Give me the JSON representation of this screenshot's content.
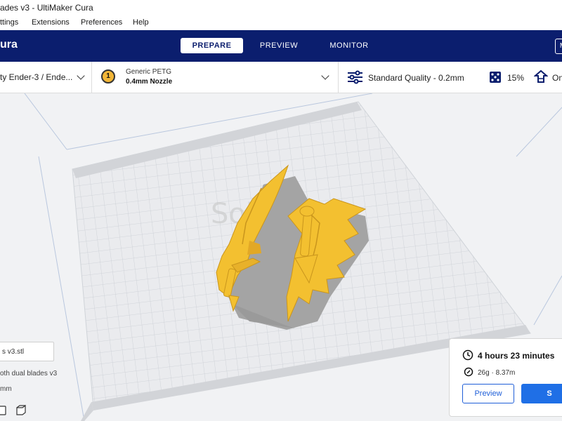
{
  "window": {
    "title": "ades v3 - UltiMaker Cura"
  },
  "menu": [
    "ttings",
    "Extensions",
    "Preferences",
    "Help"
  ],
  "header": {
    "brand": "ura",
    "tabs": [
      "PREPARE",
      "PREVIEW",
      "MONITOR"
    ],
    "active_tab": "PREPARE",
    "right_button": "M"
  },
  "settings": {
    "printer": "ty Ender-3 / Ende...",
    "extruder_number": "1",
    "material": "Generic PETG",
    "nozzle": "0.4mm Nozzle",
    "quality": "Standard Quality - 0.2mm",
    "infill": "15%",
    "support": "On"
  },
  "object": {
    "file_name": "s v3.stl",
    "name": "oth dual blades v3",
    "dimensions": "mm"
  },
  "print": {
    "time": "4 hours 23 minutes",
    "material_usage": "26g · 8.37m",
    "preview_label": "Preview",
    "slice_label": "S"
  },
  "colors": {
    "header": "#0b1e6e",
    "model": "#f3c030",
    "accent": "#1f6fe6"
  }
}
